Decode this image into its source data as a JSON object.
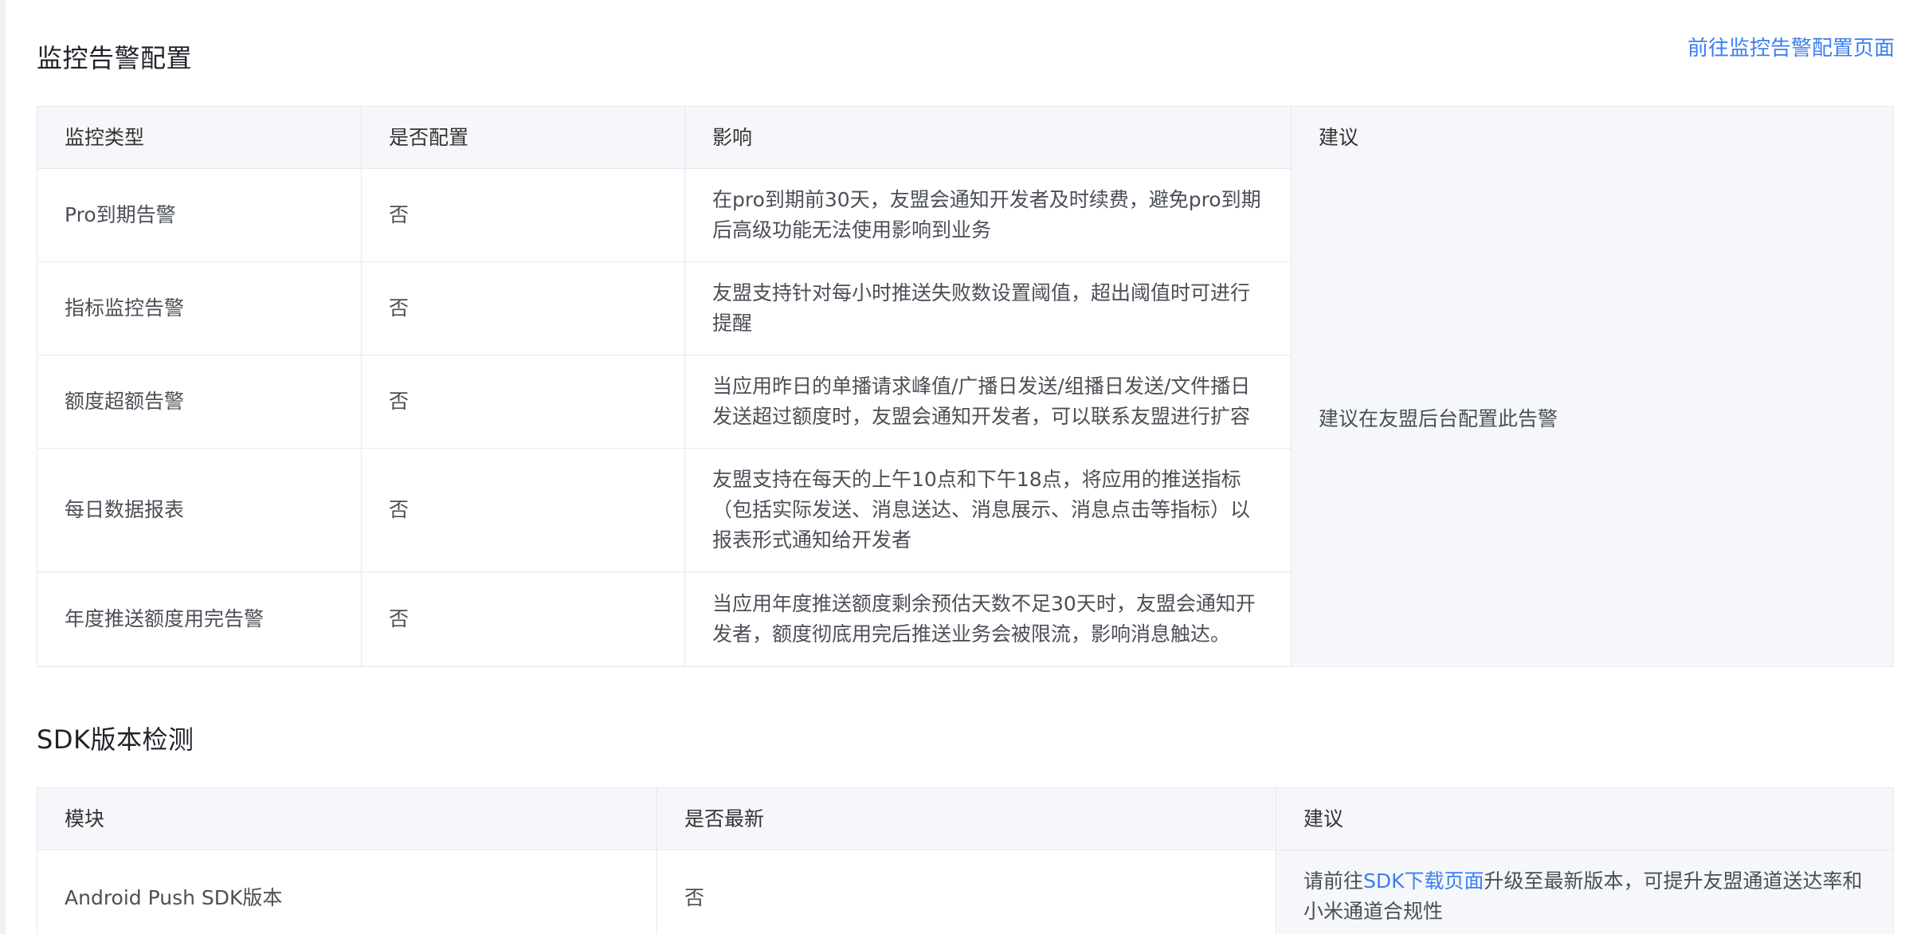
{
  "monitor": {
    "title": "监控告警配置",
    "goto_link": "前往监控告警配置页面",
    "headers": [
      "监控类型",
      "是否配置",
      "影响",
      "建议"
    ],
    "rows": [
      {
        "type": "Pro到期告警",
        "configured": "否",
        "impact": "在pro到期前30天，友盟会通知开发者及时续费，避免pro到期后高级功能无法使用影响到业务"
      },
      {
        "type": "指标监控告警",
        "configured": "否",
        "impact": "友盟支持针对每小时推送失败数设置阈值，超出阈值时可进行提醒"
      },
      {
        "type": "额度超额告警",
        "configured": "否",
        "impact": "当应用昨日的单播请求峰值/广播日发送/组播日发送/文件播日发送超过额度时，友盟会通知开发者，可以联系友盟进行扩容"
      },
      {
        "type": "每日数据报表",
        "configured": "否",
        "impact": "友盟支持在每天的上午10点和下午18点，将应用的推送指标（包括实际发送、消息送达、消息展示、消息点击等指标）以报表形式通知给开发者"
      },
      {
        "type": "年度推送额度用完告警",
        "configured": "否",
        "impact": "当应用年度推送额度剩余预估天数不足30天时，友盟会通知开发者，额度彻底用完后推送业务会被限流，影响消息触达。"
      }
    ],
    "suggestion": "建议在友盟后台配置此告警"
  },
  "sdk": {
    "title": "SDK版本检测",
    "headers": [
      "模块",
      "是否最新",
      "建议"
    ],
    "rows": [
      {
        "module": "Android Push SDK版本",
        "latest": "否",
        "suggestion_prefix": "请前往",
        "suggestion_link": "SDK下载页面",
        "suggestion_suffix": "升级至最新版本，可提升友盟通道送达率和小米通道合规性"
      }
    ]
  },
  "colors": {
    "link": "#3b7ff0",
    "header_bg": "#f5f7fa",
    "border": "#e6e8eb"
  }
}
